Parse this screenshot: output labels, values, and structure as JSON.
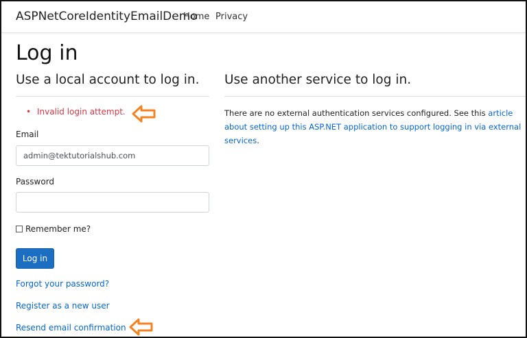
{
  "navbar": {
    "brand": "ASPNetCoreIdentityEmailDemo",
    "links": [
      "Home",
      "Privacy"
    ]
  },
  "page": {
    "title": "Log in",
    "left_heading": "Use a local account to log in.",
    "right_heading": "Use another service to log in."
  },
  "validation": {
    "bullet": "•",
    "error": "Invalid login attempt."
  },
  "form": {
    "email_label": "Email",
    "email_value": "admin@tektutorialshub.com",
    "password_label": "Password",
    "password_value": "",
    "remember_label": "Remember me?",
    "remember_checked": false,
    "login_button": "Log in"
  },
  "links": {
    "forgot": "Forgot your password?",
    "register": "Register as a new user",
    "resend": "Resend email confirmation"
  },
  "external": {
    "text": "There are no external authentication services configured. See this ",
    "link_text": "article about setting up this ASP.NET application to support logging in via external services",
    "suffix": "."
  },
  "annotations": {
    "arrow_color": "#f58220",
    "arrow_icon": "left-arrow-icon"
  },
  "colors": {
    "primary": "#1b6ec2",
    "link": "#0366d6",
    "error": "#dc3545"
  }
}
